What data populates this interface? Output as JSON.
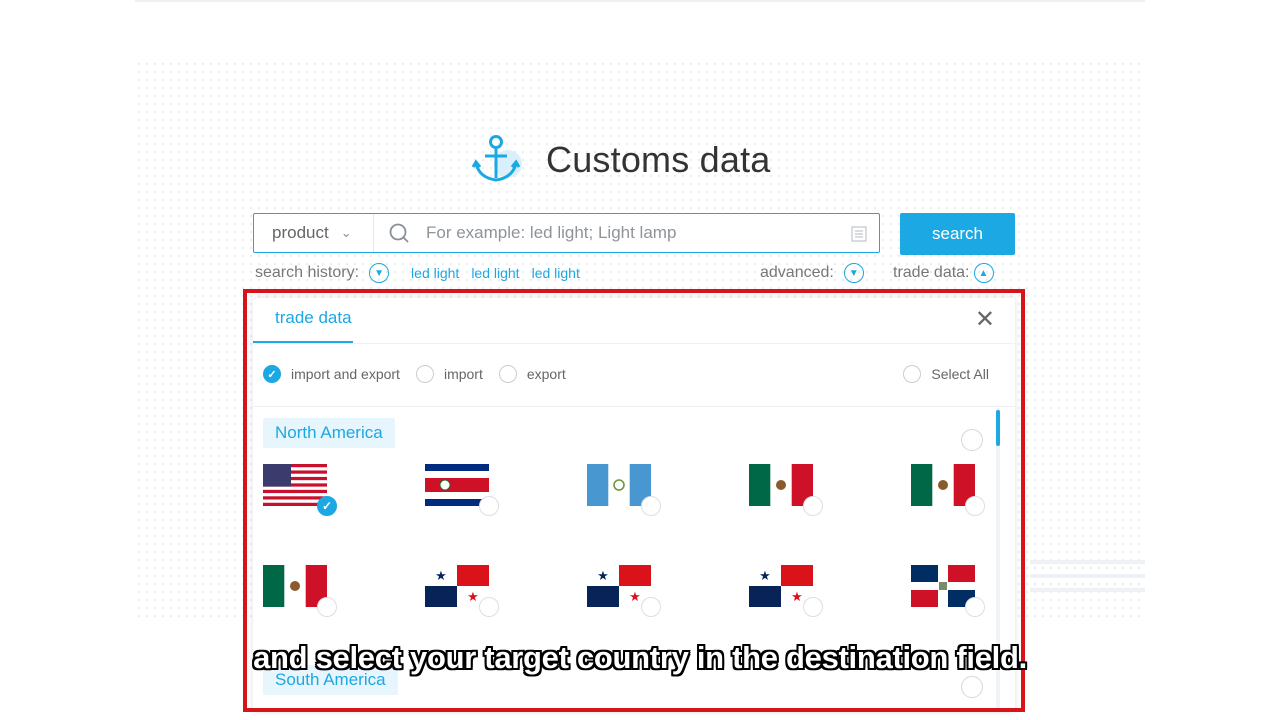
{
  "header": {
    "title": "Customs data",
    "logo_icon": "anchor-icon"
  },
  "search": {
    "category_value": "product",
    "placeholder": "For example: led light; Light lamp",
    "button_label": "search"
  },
  "history": {
    "label": "search history:",
    "tags": [
      "led light",
      "led light",
      "led light"
    ],
    "advanced_label": "advanced:",
    "trade_data_label": "trade data:"
  },
  "panel": {
    "tab_label": "trade data",
    "close_icon": "close-icon",
    "options": [
      {
        "label": "import and export",
        "checked": true
      },
      {
        "label": "import",
        "checked": false
      },
      {
        "label": "export",
        "checked": false
      }
    ],
    "select_all_label": "Select All",
    "regions": [
      {
        "name": "North America",
        "flags": [
          {
            "country": "United States",
            "flag": "flag-us",
            "selected": true
          },
          {
            "country": "Costa Rica",
            "flag": "flag-costa-rica",
            "selected": false
          },
          {
            "country": "Guatemala",
            "flag": "flag-guatemala",
            "selected": false
          },
          {
            "country": "Mexico",
            "flag": "flag-mexico",
            "selected": false
          },
          {
            "country": "Mexico",
            "flag": "flag-mexico",
            "selected": false
          },
          {
            "country": "Mexico",
            "flag": "flag-mexico",
            "selected": false
          },
          {
            "country": "Panama",
            "flag": "flag-panama",
            "selected": false
          },
          {
            "country": "Panama",
            "flag": "flag-panama",
            "selected": false
          },
          {
            "country": "Panama",
            "flag": "flag-panama",
            "selected": false
          },
          {
            "country": "Dominican Republic",
            "flag": "flag-dominican-republic",
            "selected": false
          }
        ]
      },
      {
        "name": "South America",
        "flags": []
      }
    ]
  },
  "caption": "and select your target country in the destination field.",
  "colors": {
    "accent": "#1ba8e3",
    "highlight": "#d7141a",
    "text": "#333333"
  }
}
